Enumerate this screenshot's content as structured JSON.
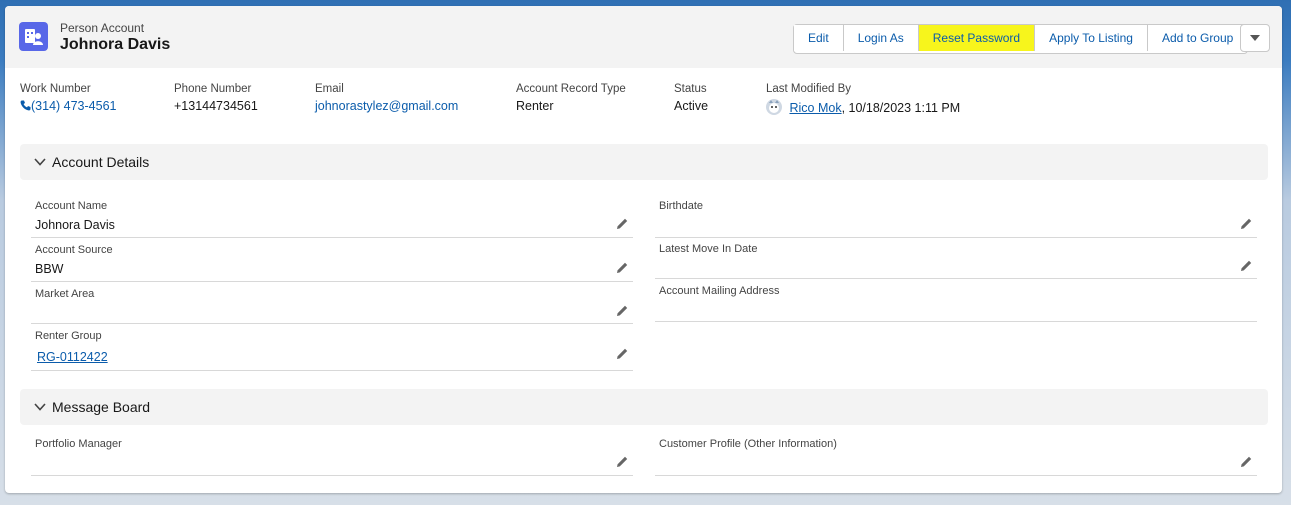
{
  "header": {
    "object_type": "Person Account",
    "record_name": "Johnora Davis",
    "icon": "person-account-icon",
    "actions": [
      "Edit",
      "Login As",
      "Reset Password",
      "Apply To Listing",
      "Add to Group"
    ],
    "highlighted_action": "Reset Password",
    "highlight_color": "#f7f51c"
  },
  "highlights": {
    "work_number": {
      "label": "Work Number",
      "value": "(314) 473-4561"
    },
    "phone_number": {
      "label": "Phone Number",
      "value": "+13144734561"
    },
    "email": {
      "label": "Email",
      "value": "johnorastylez@gmail.com"
    },
    "record_type": {
      "label": "Account Record Type",
      "value": "Renter"
    },
    "status": {
      "label": "Status",
      "value": "Active"
    },
    "last_modified": {
      "label": "Last Modified By",
      "user": "Rico Mok",
      "date": ", 10/18/2023 1:11 PM"
    }
  },
  "account_details": {
    "title": "Account Details",
    "left": [
      {
        "label": "Account Name",
        "value": "Johnora Davis"
      },
      {
        "label": "Account Source",
        "value": "BBW"
      },
      {
        "label": "Market Area",
        "value": ""
      },
      {
        "label": "Renter Group",
        "value": "RG-0112422"
      }
    ],
    "right": [
      {
        "label": "Birthdate",
        "value": ""
      },
      {
        "label": "Latest Move In Date",
        "value": ""
      },
      {
        "label": "Account Mailing Address",
        "value": ""
      }
    ]
  },
  "message_board": {
    "title": "Message Board",
    "left": [
      {
        "label": "Portfolio Manager",
        "value": ""
      }
    ],
    "right": [
      {
        "label": "Customer Profile (Other Information)",
        "value": ""
      }
    ]
  },
  "colors": {
    "link": "#0b5cab",
    "brand_icon": "#5867e8",
    "section_bg": "#f3f3f3"
  }
}
